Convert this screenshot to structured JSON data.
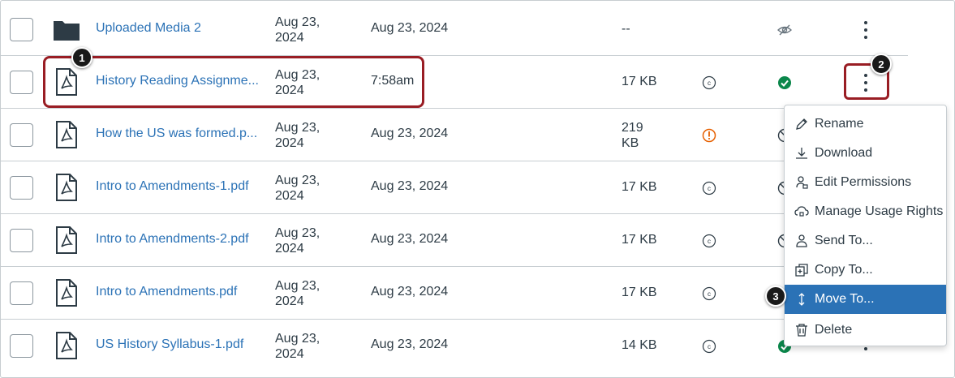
{
  "rows": [
    {
      "name": "Uploaded Media 2",
      "created_line1": "Aug 23,",
      "created_line2": "2024",
      "modified": "Aug 23, 2024",
      "size_line1": "--",
      "size_line2": "",
      "type": "folder",
      "usage": "none",
      "published": "hidden"
    },
    {
      "name": "History Reading Assignme...",
      "created_line1": "Aug 23,",
      "created_line2": "2024",
      "modified": "7:58am",
      "size_line1": "17 KB",
      "size_line2": "",
      "type": "pdf",
      "usage": "copyright",
      "published": "published"
    },
    {
      "name": "How the US was formed.p...",
      "created_line1": "Aug 23,",
      "created_line2": "2024",
      "modified": "Aug 23, 2024",
      "size_line1": "219",
      "size_line2": "KB",
      "type": "pdf",
      "usage": "warning",
      "published": "unpublished"
    },
    {
      "name": "Intro to Amendments-1.pdf",
      "created_line1": "Aug 23,",
      "created_line2": "2024",
      "modified": "Aug 23, 2024",
      "size_line1": "17 KB",
      "size_line2": "",
      "type": "pdf",
      "usage": "copyright",
      "published": "unpublished"
    },
    {
      "name": "Intro to Amendments-2.pdf",
      "created_line1": "Aug 23,",
      "created_line2": "2024",
      "modified": "Aug 23, 2024",
      "size_line1": "17 KB",
      "size_line2": "",
      "type": "pdf",
      "usage": "copyright",
      "published": "unpublished"
    },
    {
      "name": "Intro to Amendments.pdf",
      "created_line1": "Aug 23,",
      "created_line2": "2024",
      "modified": "Aug 23, 2024",
      "size_line1": "17 KB",
      "size_line2": "",
      "type": "pdf",
      "usage": "copyright",
      "published": "unpublished"
    },
    {
      "name": "US History Syllabus-1.pdf",
      "created_line1": "Aug 23,",
      "created_line2": "2024",
      "modified": "Aug 23, 2024",
      "size_line1": "14 KB",
      "size_line2": "",
      "type": "pdf",
      "usage": "copyright",
      "published": "published"
    }
  ],
  "menu": {
    "items": [
      {
        "label": "Rename",
        "icon": "pencil-icon"
      },
      {
        "label": "Download",
        "icon": "download-icon"
      },
      {
        "label": "Edit Permissions",
        "icon": "permissions-icon"
      },
      {
        "label": "Manage Usage Rights",
        "icon": "cloud-lock-icon"
      },
      {
        "label": "Send To...",
        "icon": "user-icon"
      },
      {
        "label": "Copy To...",
        "icon": "copy-icon"
      },
      {
        "label": "Move To...",
        "icon": "move-icon",
        "active": true
      },
      {
        "label": "Delete",
        "icon": "trash-icon"
      }
    ]
  },
  "callouts": [
    "1",
    "2",
    "3"
  ],
  "colors": {
    "link": "#2b72b6",
    "highlight": "#991d24",
    "published": "#0b874b",
    "warning": "#e66000",
    "active_menu": "#2b72b6"
  }
}
